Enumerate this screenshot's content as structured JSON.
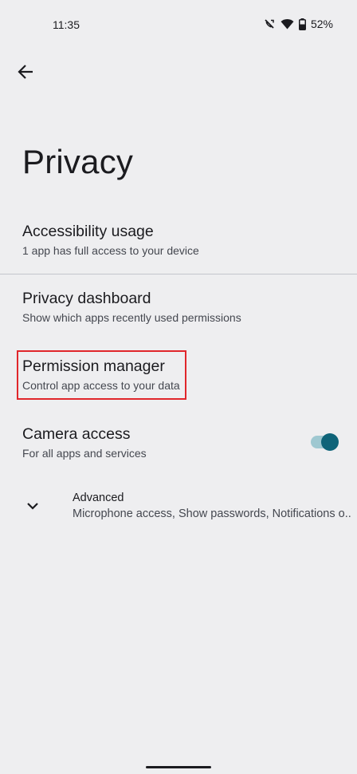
{
  "status_bar": {
    "time": "11:35",
    "battery": "52%",
    "icons": [
      "no-call-icon",
      "wifi-icon",
      "battery-icon"
    ]
  },
  "header": {
    "back_icon": "arrow-back-icon"
  },
  "page": {
    "title": "Privacy"
  },
  "items": [
    {
      "title": "Accessibility usage",
      "summary": "1 app has full access to your device"
    },
    {
      "title": "Privacy dashboard",
      "summary": "Show which apps recently used permissions"
    },
    {
      "title": "Permission manager",
      "summary": "Control app access to your data",
      "highlighted": true
    },
    {
      "title": "Camera access",
      "summary": "For all apps and services",
      "toggle_on": true
    }
  ],
  "advanced": {
    "title": "Advanced",
    "summary": "Microphone access, Show passwords, Notifications o.."
  },
  "colors": {
    "background": "#eeeef0",
    "accent": "#0f6479",
    "highlight_border": "#e0262b"
  }
}
